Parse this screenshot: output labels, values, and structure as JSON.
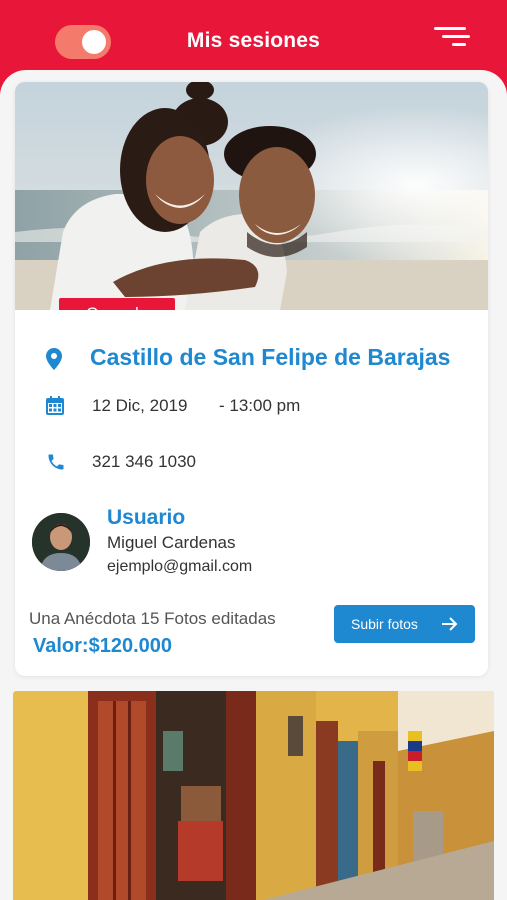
{
  "header": {
    "title": "Mis sesiones",
    "accent_color": "#e8173a",
    "toggle_icon": "toggle-icon",
    "menu_icon": "menu-icon"
  },
  "session": {
    "status_badge": "Cancela",
    "place": "Castillo de San Felipe de Barajas",
    "date": "12 Dic, 2019",
    "time": "- 13:00 pm",
    "phone": "321 346 1030",
    "user_label": "Usuario",
    "user_name": "Miguel Cardenas",
    "user_email": "ejemplo@gmail.com",
    "package": "Una Anécdota 15 Fotos editadas",
    "price": "Valor:$120.000",
    "upload_button": "Subir fotos",
    "link_color": "#1e88d0"
  }
}
